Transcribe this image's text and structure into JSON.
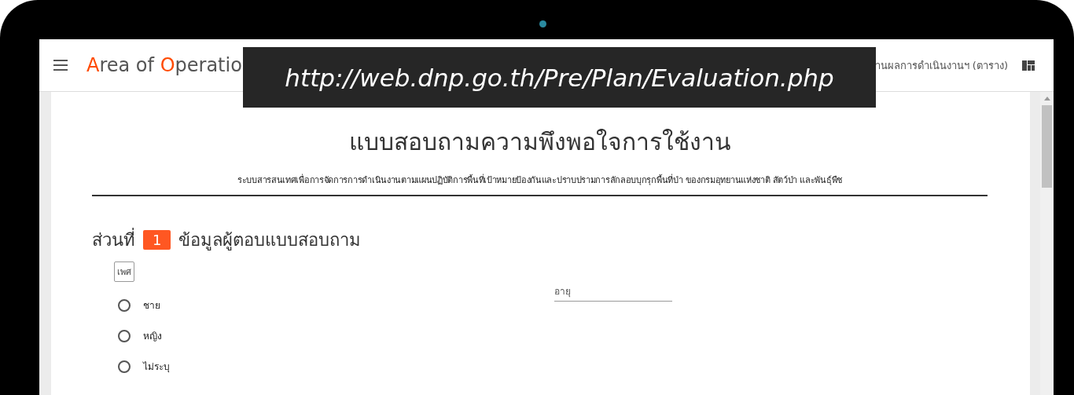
{
  "header": {
    "logo": [
      {
        "text": "A",
        "accent": true
      },
      {
        "text": "rea of ",
        "accent": false
      },
      {
        "text": "O",
        "accent": true
      },
      {
        "text": "peratio",
        "accent": false
      }
    ],
    "nav_link": "านผลการดำเนินงานฯ (ตาราง)"
  },
  "url_banner": "http://web.dnp.go.th/Pre/Plan/Evaluation.php",
  "form": {
    "title": "แบบสอบถามความพึงพอใจการใช้งาน",
    "subtitle": "ระบบสารสนเทศเพื่อการจัดการการดำเนินงานตามแผนปฏิบัติการพื้นที่เป้าหมายป้องกันและปราบปรามการลักลอบบุกรุกพื้นที่ป่า ของกรมอุทยานแห่งชาติ สัตว์ป่า และพันธุ์พืช",
    "section": {
      "prefix": "ส่วนที่",
      "number": "1",
      "title": "ข้อมูลผู้ตอบแบบสอบถาม"
    },
    "gender_label": "เพศ",
    "gender_options": [
      {
        "label": "ชาย",
        "selected": false
      },
      {
        "label": "หญิง",
        "selected": false
      },
      {
        "label": "ไม่ระบุ",
        "selected": false
      }
    ],
    "age_field": {
      "placeholder": "อายุ"
    }
  }
}
